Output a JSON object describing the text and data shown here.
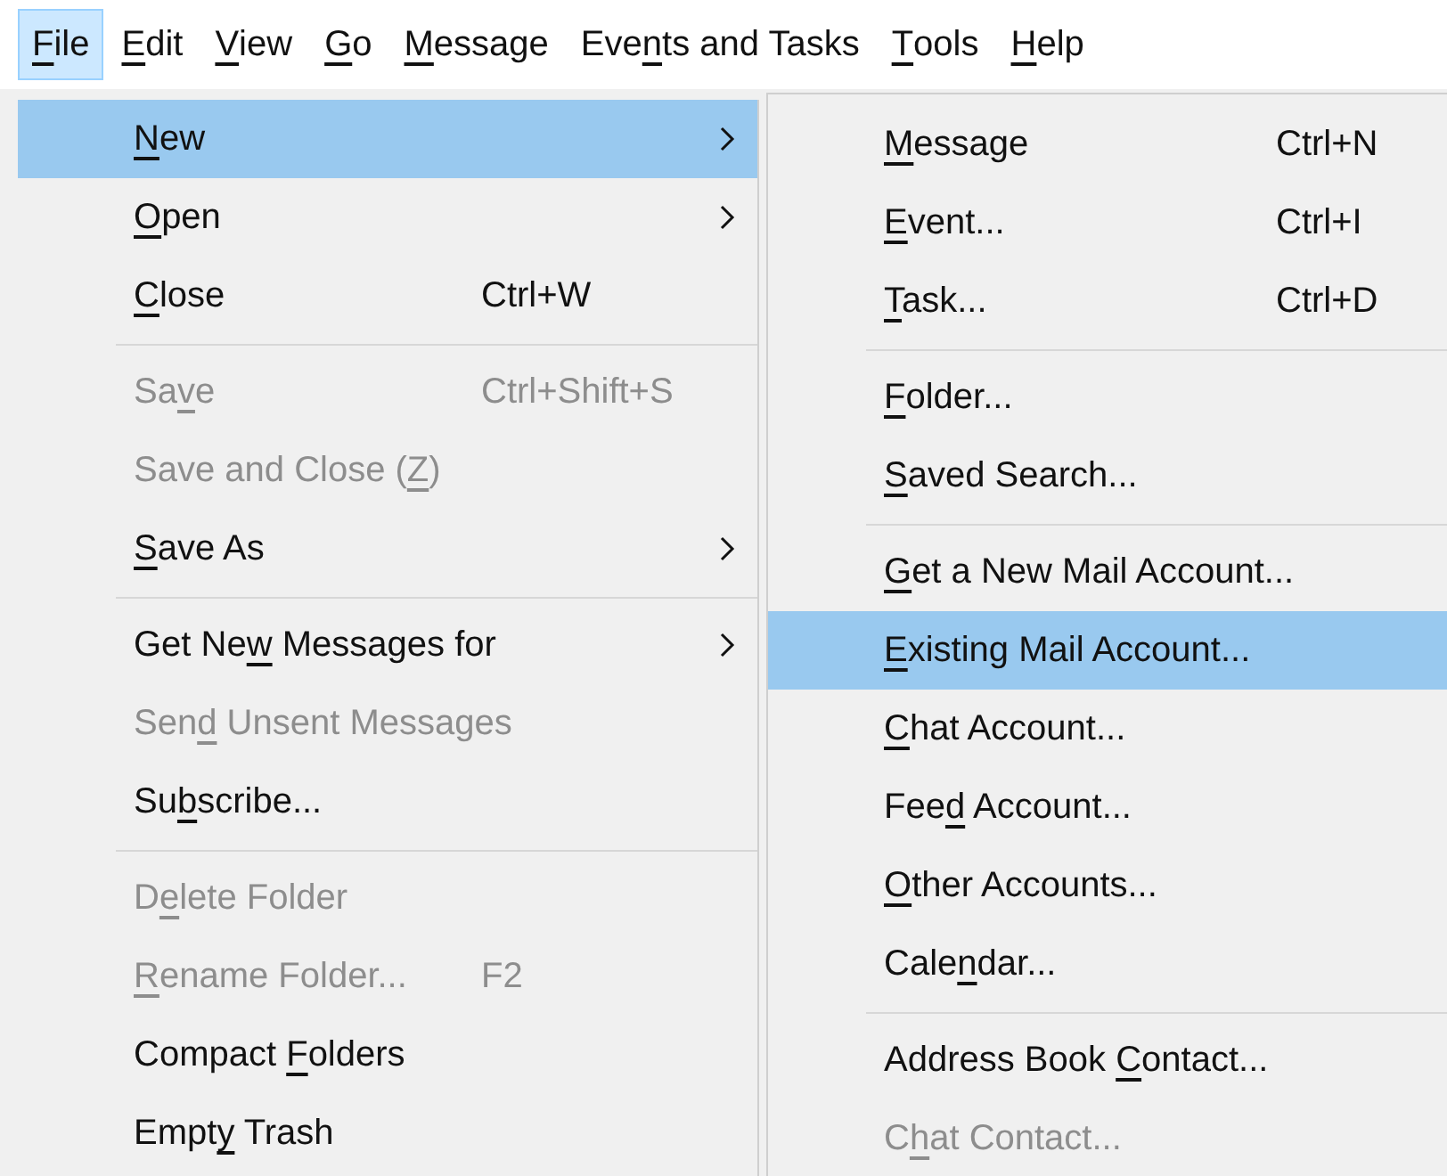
{
  "menubar": [
    {
      "label": [
        {
          "text": "F",
          "underlined": true
        },
        {
          "text": "ile",
          "underlined": false
        }
      ],
      "selected": true
    },
    {
      "label": [
        {
          "text": "E",
          "underlined": true
        },
        {
          "text": "dit",
          "underlined": false
        }
      ],
      "selected": false
    },
    {
      "label": [
        {
          "text": "V",
          "underlined": true
        },
        {
          "text": "iew",
          "underlined": false
        }
      ],
      "selected": false
    },
    {
      "label": [
        {
          "text": "G",
          "underlined": true
        },
        {
          "text": "o",
          "underlined": false
        }
      ],
      "selected": false
    },
    {
      "label": [
        {
          "text": "M",
          "underlined": true
        },
        {
          "text": "essage",
          "underlined": false
        }
      ],
      "selected": false
    },
    {
      "label": [
        {
          "text": "Eve",
          "underlined": false
        },
        {
          "text": "n",
          "underlined": true
        },
        {
          "text": "ts and Tasks",
          "underlined": false
        }
      ],
      "selected": false
    },
    {
      "label": [
        {
          "text": "T",
          "underlined": true
        },
        {
          "text": "ools",
          "underlined": false
        }
      ],
      "selected": false
    },
    {
      "label": [
        {
          "text": "H",
          "underlined": true
        },
        {
          "text": "elp",
          "underlined": false
        }
      ],
      "selected": false
    }
  ],
  "file_menu": [
    {
      "kind": "item",
      "label": [
        {
          "text": "N",
          "underlined": true
        },
        {
          "text": "ew",
          "underlined": false
        }
      ],
      "has_submenu": true,
      "disabled": false,
      "selected": true
    },
    {
      "kind": "item",
      "label": [
        {
          "text": "O",
          "underlined": true
        },
        {
          "text": "pen",
          "underlined": false
        }
      ],
      "has_submenu": true,
      "disabled": false,
      "selected": false
    },
    {
      "kind": "item",
      "label": [
        {
          "text": "C",
          "underlined": true
        },
        {
          "text": "lose",
          "underlined": false
        }
      ],
      "shortcut": "Ctrl+W",
      "has_submenu": false,
      "disabled": false,
      "selected": false
    },
    {
      "kind": "separator"
    },
    {
      "kind": "item",
      "label": [
        {
          "text": "Sa",
          "underlined": false
        },
        {
          "text": "v",
          "underlined": true
        },
        {
          "text": "e",
          "underlined": false
        }
      ],
      "shortcut": "Ctrl+Shift+S",
      "has_submenu": false,
      "disabled": true,
      "selected": false
    },
    {
      "kind": "item",
      "label": [
        {
          "text": "Save and Close (",
          "underlined": false
        },
        {
          "text": "Z",
          "underlined": true
        },
        {
          "text": ")",
          "underlined": false
        }
      ],
      "has_submenu": false,
      "disabled": true,
      "selected": false
    },
    {
      "kind": "item",
      "label": [
        {
          "text": "S",
          "underlined": true
        },
        {
          "text": "ave As",
          "underlined": false
        }
      ],
      "has_submenu": true,
      "disabled": false,
      "selected": false
    },
    {
      "kind": "separator"
    },
    {
      "kind": "item",
      "label": [
        {
          "text": "Get Ne",
          "underlined": false
        },
        {
          "text": "w",
          "underlined": true
        },
        {
          "text": " Messages for",
          "underlined": false
        }
      ],
      "has_submenu": true,
      "disabled": false,
      "selected": false
    },
    {
      "kind": "item",
      "label": [
        {
          "text": "Sen",
          "underlined": false
        },
        {
          "text": "d",
          "underlined": true
        },
        {
          "text": " Unsent Messages",
          "underlined": false
        }
      ],
      "has_submenu": false,
      "disabled": true,
      "selected": false
    },
    {
      "kind": "item",
      "label": [
        {
          "text": "Su",
          "underlined": false
        },
        {
          "text": "b",
          "underlined": true
        },
        {
          "text": "scribe...",
          "underlined": false
        }
      ],
      "has_submenu": false,
      "disabled": false,
      "selected": false
    },
    {
      "kind": "separator"
    },
    {
      "kind": "item",
      "label": [
        {
          "text": "D",
          "underlined": false
        },
        {
          "text": "e",
          "underlined": true
        },
        {
          "text": "lete Folder",
          "underlined": false
        }
      ],
      "has_submenu": false,
      "disabled": true,
      "selected": false
    },
    {
      "kind": "item",
      "label": [
        {
          "text": "R",
          "underlined": true
        },
        {
          "text": "ename Folder...",
          "underlined": false
        }
      ],
      "shortcut": "F2",
      "has_submenu": false,
      "disabled": true,
      "selected": false
    },
    {
      "kind": "item",
      "label": [
        {
          "text": "Compact ",
          "underlined": false
        },
        {
          "text": "F",
          "underlined": true
        },
        {
          "text": "olders",
          "underlined": false
        }
      ],
      "has_submenu": false,
      "disabled": false,
      "selected": false
    },
    {
      "kind": "item",
      "label": [
        {
          "text": "Empt",
          "underlined": false
        },
        {
          "text": "y",
          "underlined": true
        },
        {
          "text": " Trash",
          "underlined": false
        }
      ],
      "has_submenu": false,
      "disabled": false,
      "selected": false
    }
  ],
  "new_submenu": [
    {
      "kind": "item",
      "label": [
        {
          "text": "M",
          "underlined": true
        },
        {
          "text": "essage",
          "underlined": false
        }
      ],
      "shortcut": "Ctrl+N",
      "disabled": false,
      "selected": false
    },
    {
      "kind": "item",
      "label": [
        {
          "text": "E",
          "underlined": true
        },
        {
          "text": "vent...",
          "underlined": false
        }
      ],
      "shortcut": "Ctrl+I",
      "disabled": false,
      "selected": false
    },
    {
      "kind": "item",
      "label": [
        {
          "text": "T",
          "underlined": true
        },
        {
          "text": "ask...",
          "underlined": false
        }
      ],
      "shortcut": "Ctrl+D",
      "disabled": false,
      "selected": false
    },
    {
      "kind": "separator"
    },
    {
      "kind": "item",
      "label": [
        {
          "text": "F",
          "underlined": true
        },
        {
          "text": "older...",
          "underlined": false
        }
      ],
      "disabled": false,
      "selected": false
    },
    {
      "kind": "item",
      "label": [
        {
          "text": "S",
          "underlined": true
        },
        {
          "text": "aved Search...",
          "underlined": false
        }
      ],
      "disabled": false,
      "selected": false
    },
    {
      "kind": "separator"
    },
    {
      "kind": "item",
      "label": [
        {
          "text": "G",
          "underlined": true
        },
        {
          "text": "et a New Mail Account...",
          "underlined": false
        }
      ],
      "disabled": false,
      "selected": false
    },
    {
      "kind": "item",
      "label": [
        {
          "text": "E",
          "underlined": true
        },
        {
          "text": "xisting Mail Account...",
          "underlined": false
        }
      ],
      "disabled": false,
      "selected": true
    },
    {
      "kind": "item",
      "label": [
        {
          "text": "C",
          "underlined": true
        },
        {
          "text": "hat Account...",
          "underlined": false
        }
      ],
      "disabled": false,
      "selected": false
    },
    {
      "kind": "item",
      "label": [
        {
          "text": "Fee",
          "underlined": false
        },
        {
          "text": "d",
          "underlined": true
        },
        {
          "text": " Account...",
          "underlined": false
        }
      ],
      "disabled": false,
      "selected": false
    },
    {
      "kind": "item",
      "label": [
        {
          "text": "O",
          "underlined": true
        },
        {
          "text": "ther Accounts...",
          "underlined": false
        }
      ],
      "disabled": false,
      "selected": false
    },
    {
      "kind": "item",
      "label": [
        {
          "text": "Cale",
          "underlined": false
        },
        {
          "text": "n",
          "underlined": true
        },
        {
          "text": "dar...",
          "underlined": false
        }
      ],
      "disabled": false,
      "selected": false
    },
    {
      "kind": "separator"
    },
    {
      "kind": "item",
      "label": [
        {
          "text": "Address Book ",
          "underlined": false
        },
        {
          "text": "C",
          "underlined": true
        },
        {
          "text": "ontact...",
          "underlined": false
        }
      ],
      "disabled": false,
      "selected": false
    },
    {
      "kind": "item",
      "label": [
        {
          "text": "C",
          "underlined": false
        },
        {
          "text": "h",
          "underlined": true
        },
        {
          "text": "at Contact...",
          "underlined": false
        }
      ],
      "disabled": true,
      "selected": false
    }
  ]
}
